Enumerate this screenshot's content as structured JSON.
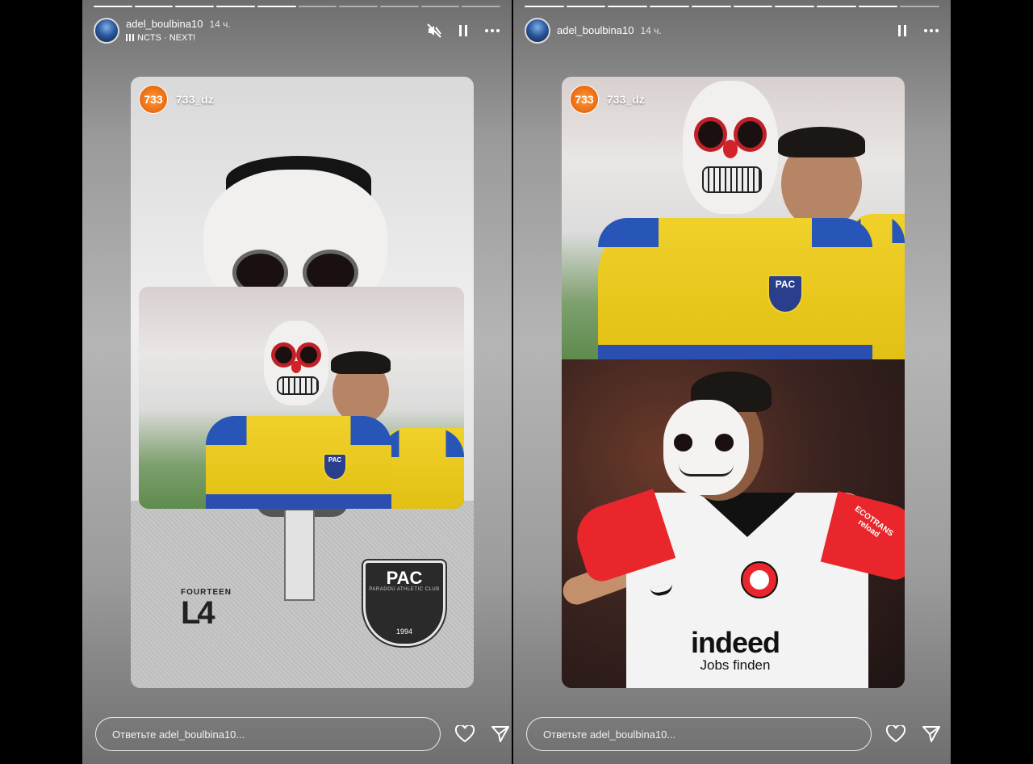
{
  "stories": [
    {
      "username": "adel_boulbina10",
      "time": "14 ч.",
      "music_label": "NCTS · NEXT!",
      "reply_placeholder": "Ответьте adel_boulbina10...",
      "progress_segments": 10,
      "progress_done": 5,
      "shared_post": {
        "account_logo": "733",
        "account_name": "733_dz"
      },
      "icons": [
        "mute-icon",
        "pause-icon",
        "more-icon",
        "heart-icon",
        "send-icon"
      ],
      "jersey_logo": {
        "brand_text": "FOURTEEN",
        "brand_mark": "L4"
      },
      "badge": {
        "text": "PAC",
        "subtext": "PARADOU ATHLETIC CLUB",
        "year": "1994"
      },
      "inner_badge": "PAC"
    },
    {
      "username": "adel_boulbina10",
      "time": "14 ч.",
      "reply_placeholder": "Ответьте adel_boulbina10...",
      "progress_segments": 10,
      "progress_done": 9,
      "shared_post": {
        "account_logo": "733",
        "account_name": "733_dz"
      },
      "icons": [
        "pause-icon",
        "more-icon",
        "heart-icon",
        "send-icon"
      ],
      "top_badge": "PAC",
      "sponsor": {
        "line1": "indeed",
        "line2": "Jobs finden"
      },
      "sleeve_text": "ECOTRANS\nreload"
    }
  ],
  "colors": {
    "jersey_yellow": "#f0d12a",
    "jersey_blue": "#2855b8",
    "clown_red": "#d2232b",
    "chip_orange": "#e86a12",
    "eintracht_red": "#e8262c"
  }
}
